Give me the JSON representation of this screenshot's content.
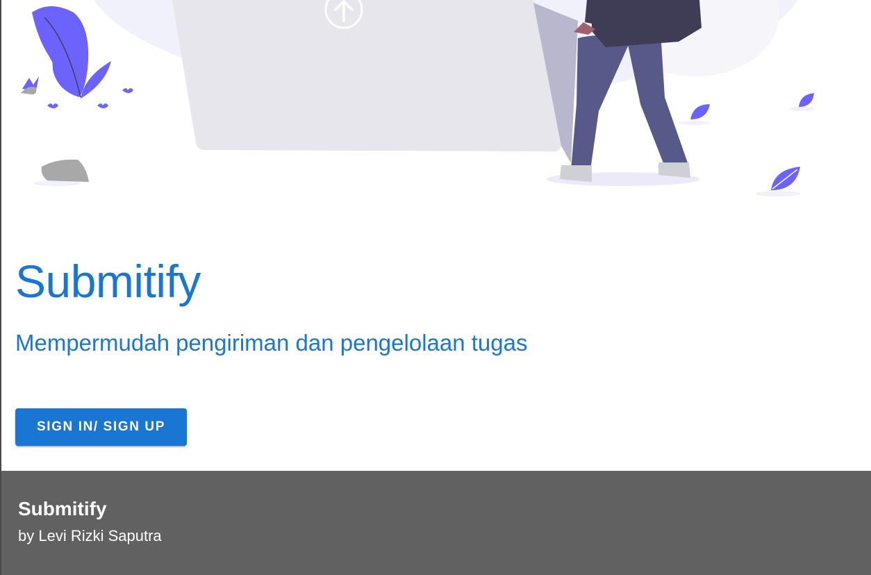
{
  "hero": {
    "title": "Submitify",
    "tagline": "Mempermudah pengiriman dan pengelolaan tugas",
    "cta_label": "SIGN IN/ SIGN UP"
  },
  "footer": {
    "title": "Submitify",
    "author": "by Levi Rizki Saputra"
  },
  "colors": {
    "primary": "#1976d2",
    "footer_bg": "#616161",
    "illustration_accent": "#6c63ff"
  }
}
